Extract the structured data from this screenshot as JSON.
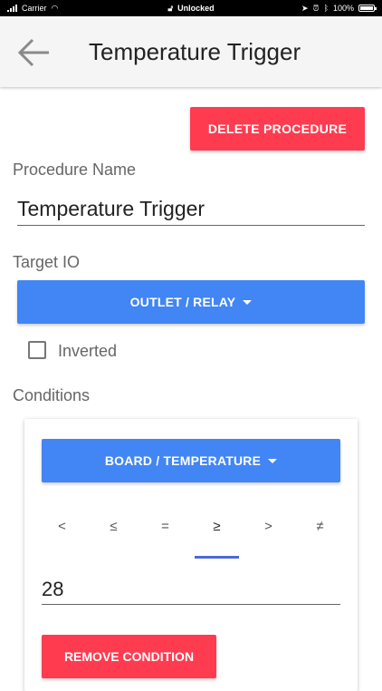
{
  "status_bar": {
    "carrier": "Carrier",
    "lock_label": "Unlocked",
    "battery": "100%"
  },
  "header": {
    "title": "Temperature Trigger",
    "back_icon": "arrow-left-icon"
  },
  "actions": {
    "delete_label": "DELETE PROCEDURE"
  },
  "form": {
    "procedure_name_label": "Procedure Name",
    "procedure_name_value": "Temperature Trigger",
    "target_io_label": "Target IO",
    "target_io_value": "OUTLET / RELAY",
    "inverted_label": "Inverted",
    "inverted_checked": false,
    "conditions_label": "Conditions"
  },
  "condition": {
    "source_value": "BOARD / TEMPERATURE",
    "operators": [
      "<",
      "≤",
      "=",
      "≥",
      ">",
      "≠"
    ],
    "selected_operator_index": 3,
    "value": "28",
    "remove_label": "REMOVE CONDITION"
  },
  "colors": {
    "primary": "#4285f4",
    "danger": "#ff3b50",
    "tab_indicator": "#4a69d6"
  }
}
